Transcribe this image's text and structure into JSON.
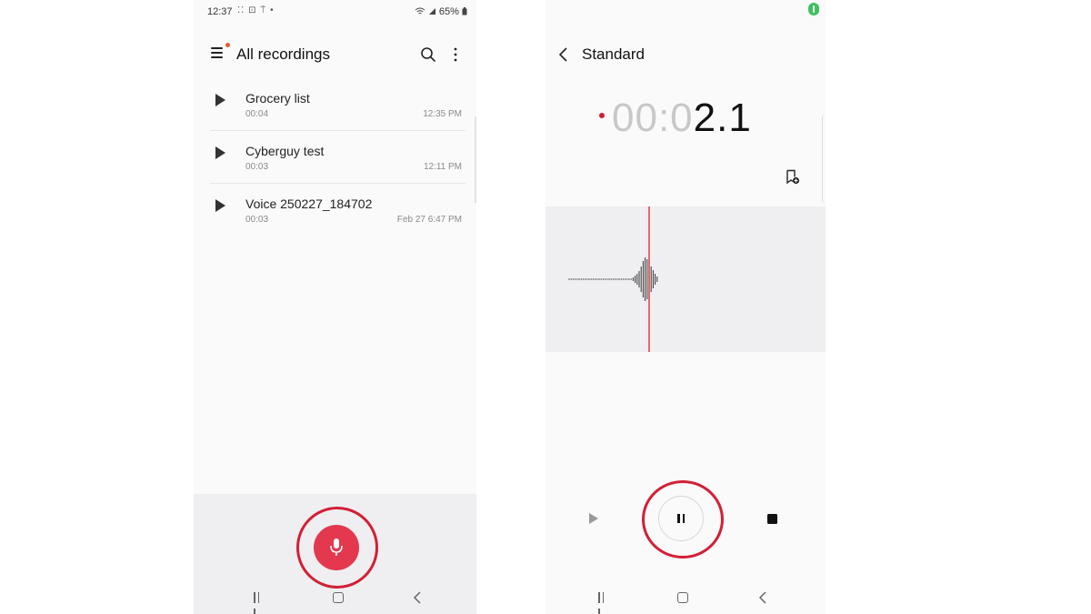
{
  "left_screen": {
    "status_bar": {
      "time": "12:37",
      "left_icons": "⁚⁚ ⊡ ⍑ •",
      "battery": "65%"
    },
    "header": {
      "title": "All recordings",
      "menu_icon": "menu-icon",
      "search_icon": "search-icon",
      "more_icon": "more-vert-icon",
      "notification_dot_color": "#e8572c"
    },
    "recordings": [
      {
        "name": "Grocery list",
        "duration": "00:04",
        "date": "12:35 PM"
      },
      {
        "name": "Cyberguy test",
        "duration": "00:03",
        "date": "12:11 PM"
      },
      {
        "name": "Voice 250227_184702",
        "duration": "00:03",
        "date": "Feb 27 6:47 PM"
      }
    ],
    "record_button": {
      "icon": "microphone-icon",
      "color": "#e3384e",
      "highlight_ring_color": "#d31f35"
    }
  },
  "right_screen": {
    "header": {
      "title": "Standard",
      "back_icon": "chevron-left-icon"
    },
    "timer": {
      "dim": "00:0",
      "bright": "2.1"
    },
    "controls": {
      "play_icon": "play-icon",
      "pause_icon": "pause-icon",
      "stop_icon": "stop-icon"
    },
    "accent_color": "#d31f35",
    "playhead_color": "#e06a6f"
  },
  "navigation_bar": {
    "recent_icon": "recent-apps-icon",
    "home_icon": "home-icon",
    "back_icon": "back-icon"
  }
}
